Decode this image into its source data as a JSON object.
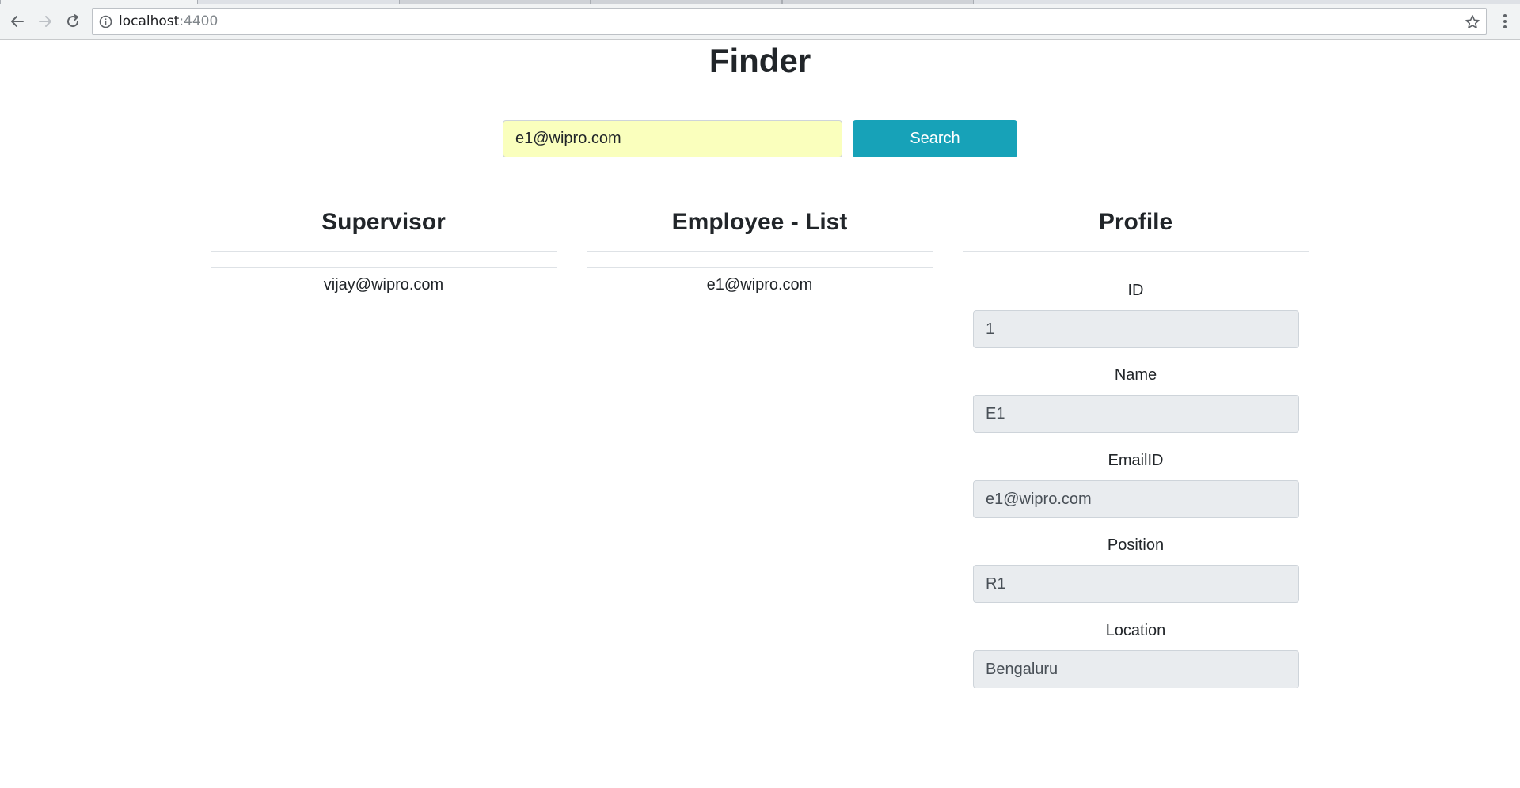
{
  "browser": {
    "url_host": "localhost",
    "url_port": ":4400"
  },
  "page": {
    "title": "Finder"
  },
  "search": {
    "value": "e1@wipro.com",
    "button_label": "Search",
    "input_bg": "#faffbd",
    "button_color": "#17a2b8"
  },
  "supervisor": {
    "heading": "Supervisor",
    "items": [
      "vijay@wipro.com"
    ]
  },
  "employee_list": {
    "heading": "Employee - List",
    "items": [
      "e1@wipro.com"
    ]
  },
  "profile": {
    "heading": "Profile",
    "fields": [
      {
        "label": "ID",
        "value": "1"
      },
      {
        "label": "Name",
        "value": "E1"
      },
      {
        "label": "EmailID",
        "value": "e1@wipro.com"
      },
      {
        "label": "Position",
        "value": "R1"
      },
      {
        "label": "Location",
        "value": "Bengaluru"
      }
    ]
  }
}
